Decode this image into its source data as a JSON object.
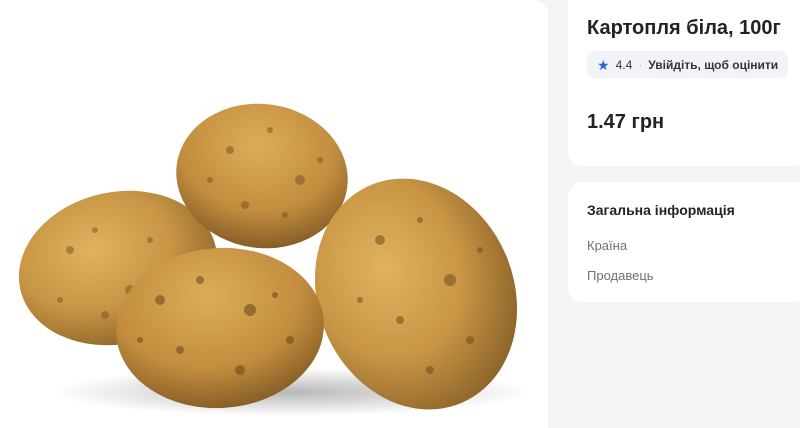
{
  "product": {
    "title": "Картопля біла, 100г",
    "rating": "4.4",
    "rating_separator": "·",
    "rate_link": "Увійдіть, щоб оцінити",
    "price": "1.47 грн",
    "image_alt": "potatoes-photo"
  },
  "info": {
    "title": "Загальна інформація",
    "rows": [
      {
        "label": "Країна"
      },
      {
        "label": "Продавець"
      }
    ]
  },
  "colors": {
    "accent_star": "#2f63d8",
    "page_bg": "#f3f4f6",
    "card_bg": "#ffffff"
  }
}
